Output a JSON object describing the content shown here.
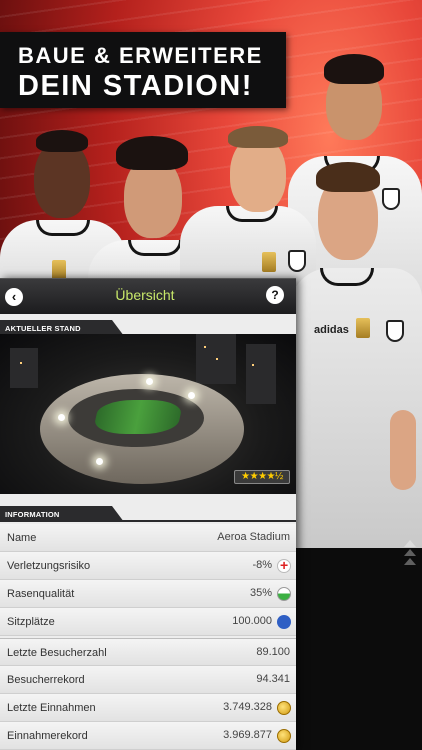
{
  "headline": {
    "line1": "BAUE & ERWEITERE",
    "line2": "DEIN STADION!"
  },
  "players": {
    "brand": "adidas"
  },
  "panel": {
    "title": "Übersicht",
    "back_icon": "back-arrow-icon",
    "help_icon": "question-mark-icon",
    "section_current": "AKTUELLER STAND",
    "section_info": "INFORMATION",
    "stadium_stars": "★★★★½",
    "star_rating": 4.5
  },
  "info": {
    "rows": [
      {
        "label": "Name",
        "value": "Aeroa Stadium",
        "icon": ""
      },
      {
        "label": "Verletzungsrisiko",
        "value": "-8%",
        "icon": "medical-cross-icon"
      },
      {
        "label": "Rasenqualität",
        "value": "35%",
        "icon": "grass-icon"
      },
      {
        "label": "Sitzplätze",
        "value": "100.000",
        "icon": "seat-icon"
      },
      {
        "label": "Letzte Besucherzahl",
        "value": "89.100",
        "icon": ""
      },
      {
        "label": "Besucherrekord",
        "value": "94.341",
        "icon": ""
      },
      {
        "label": "Letzte Einnahmen",
        "value": "3.749.328",
        "icon": "coin-icon"
      },
      {
        "label": "Einnahmerekord",
        "value": "3.969.877",
        "icon": "coin-icon"
      }
    ]
  },
  "colors": {
    "accent_title": "#c8e86a",
    "header_bg": "#0f0f10",
    "panel_bg": "#ededed"
  }
}
